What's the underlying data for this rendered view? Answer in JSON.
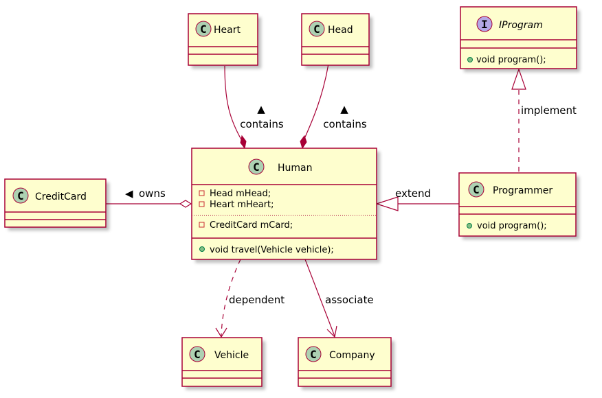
{
  "diagram": {
    "type": "UML class diagram",
    "colors": {
      "class_fill": "#FEFECE",
      "border": "#A80036",
      "class_circle": "#ADD1B2",
      "interface_circle": "#B4A7E5",
      "private_marker": "#C82930",
      "public_marker": "#84BE84"
    },
    "classes": {
      "heart": {
        "kind": "class",
        "glyph": "C",
        "name": "Heart"
      },
      "head": {
        "kind": "class",
        "glyph": "C",
        "name": "Head"
      },
      "iprogram": {
        "kind": "interface",
        "glyph": "I",
        "name": "IProgram",
        "methods": [
          "void program();"
        ]
      },
      "human": {
        "kind": "class",
        "glyph": "C",
        "name": "Human",
        "fields": [
          "Head mHead;",
          "Heart mHeart;"
        ],
        "fields2": [
          "CreditCard mCard;"
        ],
        "methods": [
          "void travel(Vehicle vehicle);"
        ]
      },
      "creditcard": {
        "kind": "class",
        "glyph": "C",
        "name": "CreditCard"
      },
      "programmer": {
        "kind": "class",
        "glyph": "C",
        "name": "Programmer",
        "methods": [
          "void program();"
        ]
      },
      "vehicle": {
        "kind": "class",
        "glyph": "C",
        "name": "Vehicle"
      },
      "company": {
        "kind": "class",
        "glyph": "C",
        "name": "Company"
      }
    },
    "relations": [
      {
        "from": "Heart",
        "to": "Human",
        "type": "composition",
        "label": "contains",
        "arrow": "▲"
      },
      {
        "from": "Head",
        "to": "Human",
        "type": "composition",
        "label": "contains",
        "arrow": "▲"
      },
      {
        "from": "CreditCard",
        "to": "Human",
        "type": "aggregation",
        "label": "owns",
        "arrow": "◀"
      },
      {
        "from": "Programmer",
        "to": "Human",
        "type": "inheritance",
        "label": "extend"
      },
      {
        "from": "Programmer",
        "to": "IProgram",
        "type": "realization",
        "label": "implement"
      },
      {
        "from": "Human",
        "to": "Vehicle",
        "type": "dependency",
        "label": "dependent"
      },
      {
        "from": "Human",
        "to": "Company",
        "type": "association",
        "label": "associate"
      }
    ]
  }
}
